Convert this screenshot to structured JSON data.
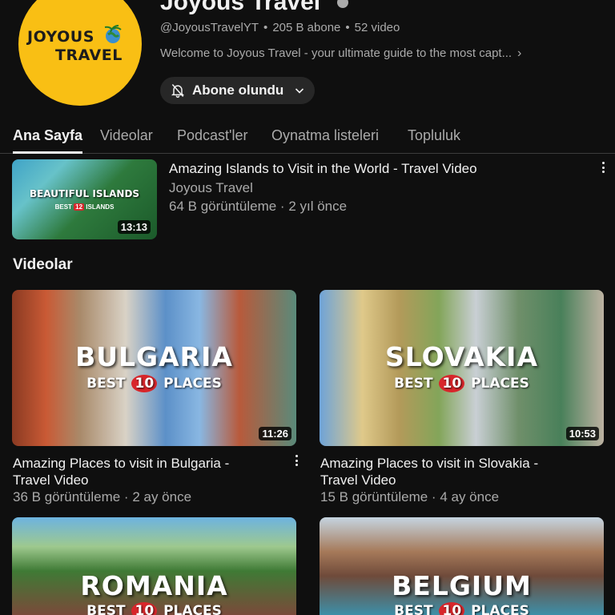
{
  "channel": {
    "name": "Joyous Travel",
    "handle": "@JoyousTravelYT",
    "subscribers": "205 B abone",
    "video_count": "52 video",
    "description": "Welcome to Joyous Travel - your ultimate guide to the most capt...",
    "logo_line1": "JOYOUS",
    "logo_line2": "TRAVEL",
    "subscribe_label": "Abone olundu"
  },
  "tabs": [
    {
      "label": "Ana Sayfa",
      "active": true
    },
    {
      "label": "Videolar"
    },
    {
      "label": "Podcast'ler"
    },
    {
      "label": "Oynatma listeleri"
    },
    {
      "label": "Topluluk"
    }
  ],
  "featured": {
    "title": "Amazing Islands to Visit in the World - Travel Video",
    "channel": "Joyous Travel",
    "views": "64 B görüntüleme",
    "age": "2 yıl önce",
    "duration": "13:13",
    "thumb_text": "BEAUTIFUL ISLANDS",
    "thumb_sub_pre": "BEST",
    "thumb_sub_num": "12",
    "thumb_sub_post": "ISLANDS"
  },
  "section_title": "Videolar",
  "videos": [
    {
      "title": "Amazing Places to visit in Bulgaria - Travel Video",
      "views": "36 B görüntüleme",
      "age": "2 ay önce",
      "duration": "11:26",
      "thumb_title": "BULGARIA",
      "thumb_pre": "BEST",
      "thumb_num": "10",
      "thumb_post": "PLACES"
    },
    {
      "title": "Amazing Places to visit in Slovakia - Travel Video",
      "views": "15 B görüntüleme",
      "age": "4 ay önce",
      "duration": "10:53",
      "thumb_title": "SLOVAKIA",
      "thumb_pre": "BEST",
      "thumb_num": "10",
      "thumb_post": "PLACES"
    },
    {
      "thumb_title": "ROMANIA",
      "thumb_pre": "BEST",
      "thumb_num": "10",
      "thumb_post": "PLACES"
    },
    {
      "thumb_title": "BELGIUM",
      "thumb_pre": "BEST",
      "thumb_num": "10",
      "thumb_post": "PLACES"
    }
  ],
  "colors": {
    "background": "#0f0f0f",
    "text_primary": "#f1f1f1",
    "text_secondary": "#aaaaaa",
    "avatar_yellow": "#f9bf14",
    "badge_red": "#d8262b"
  },
  "icons": {
    "verified": "verified-badge-icon",
    "bell": "bell-off-icon",
    "chevron": "chevron-down-icon",
    "more": "more-vertical-icon",
    "desc_more": "chevron-right-icon"
  }
}
